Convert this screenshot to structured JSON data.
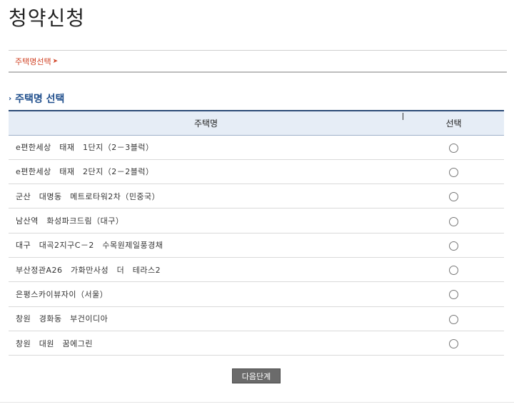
{
  "page": {
    "title": "청약신청"
  },
  "breadcrumb": {
    "label": "주택명선택",
    "arrow": "➤"
  },
  "section": {
    "bullet": "›",
    "title": "주택명 선택"
  },
  "table": {
    "headers": {
      "name": "주택명",
      "select": "선택"
    },
    "rows": [
      {
        "name": "e편한세상　태재　1단지（2－3블럭）"
      },
      {
        "name": "e편한세상　태재　2단지（2－2블럭）"
      },
      {
        "name": "군산　대명동　메트로타워2차（민중국）"
      },
      {
        "name": "남산역　화성파크드림（대구）"
      },
      {
        "name": "대구　대곡2지구C－2　수목원제일풍경채"
      },
      {
        "name": "부산정관A26　가화만사성　더　테라스2"
      },
      {
        "name": "은평스카이뷰자이（서울）"
      },
      {
        "name": "창원　경화동　부건이디아"
      },
      {
        "name": "창원　대원　꿈에그린"
      }
    ]
  },
  "buttons": {
    "next": "다음단계"
  },
  "icons": {
    "breadcrumb_arrow": "arrow-right-icon",
    "section_bullet": "chevron-right-icon",
    "radio": "radio-unselected"
  },
  "colors": {
    "accent_red": "#d2472a",
    "section_blue": "#1f4e8c",
    "header_bg": "#e6edf6",
    "button_bg": "#6b6b6b"
  }
}
